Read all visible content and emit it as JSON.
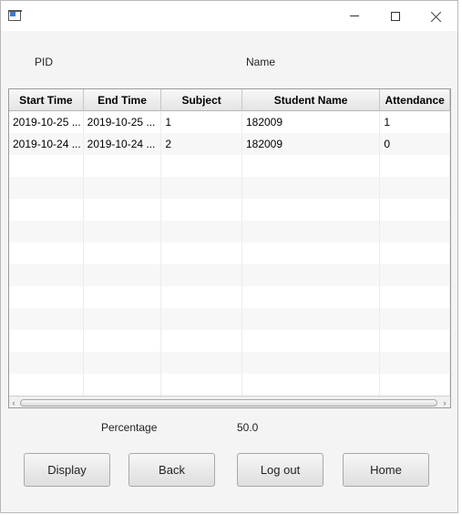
{
  "window": {
    "controls": [
      "minimize",
      "maximize",
      "close"
    ]
  },
  "labels": {
    "pid": "PID",
    "name": "Name",
    "percentage": "Percentage",
    "percentage_value": "50.0"
  },
  "table": {
    "columns": [
      "Start Time",
      "End Time",
      "Subject",
      "Student Name",
      "Attendance"
    ],
    "rows": [
      [
        "2019-10-25 ...",
        "2019-10-25 ...",
        "1",
        "182009",
        "1"
      ],
      [
        "2019-10-24 ...",
        "2019-10-24 ...",
        "2",
        "182009",
        "0"
      ]
    ]
  },
  "buttons": {
    "display": "Display",
    "back": "Back",
    "logout": "Log out",
    "home": "Home"
  }
}
